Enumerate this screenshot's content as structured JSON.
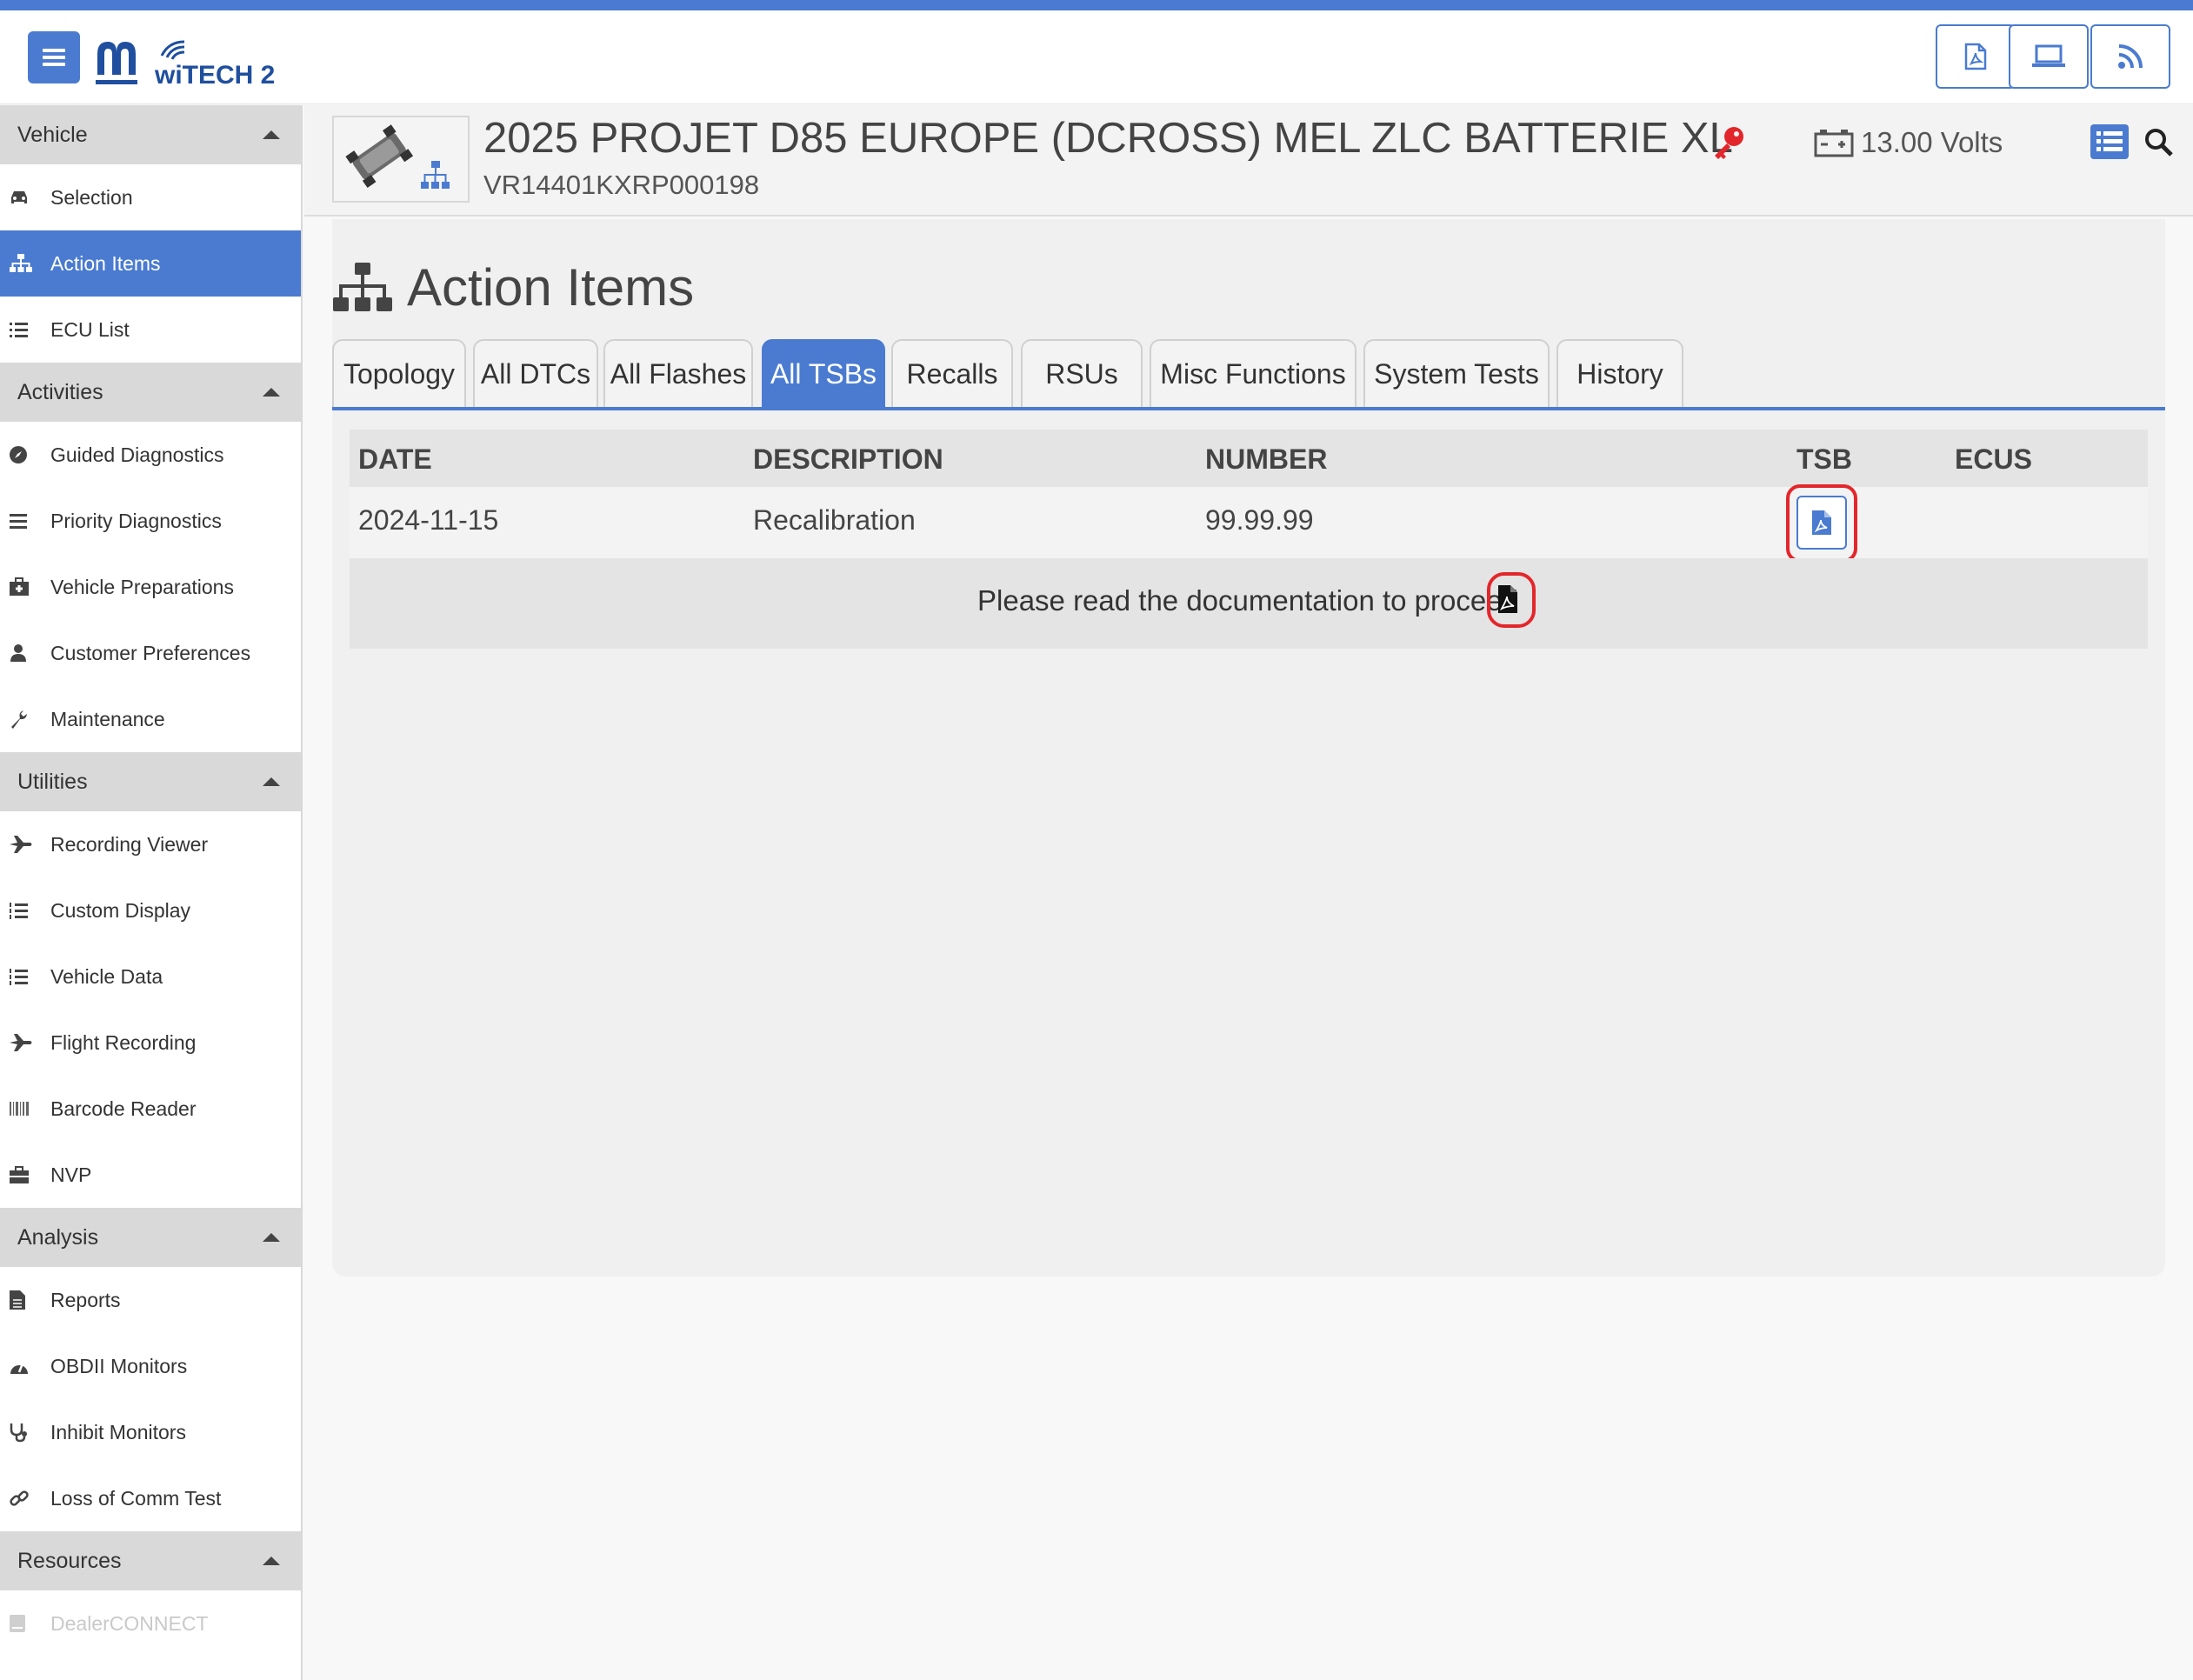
{
  "app": {
    "logo_text": "wiTECH 2",
    "accent_color": "#4a7bd0",
    "alert_color": "#e3262b"
  },
  "top_actions": [
    {
      "icon": "pdf-icon"
    },
    {
      "icon": "laptop-icon"
    },
    {
      "icon": "rss-icon"
    }
  ],
  "sidebar": {
    "sections": [
      {
        "title": "Vehicle",
        "items": [
          {
            "label": "Selection",
            "icon": "car-icon"
          },
          {
            "label": "Action Items",
            "icon": "sitemap-icon",
            "active": true
          },
          {
            "label": "ECU List",
            "icon": "list-icon"
          }
        ]
      },
      {
        "title": "Activities",
        "items": [
          {
            "label": "Guided Diagnostics",
            "icon": "compass-icon"
          },
          {
            "label": "Priority Diagnostics",
            "icon": "bars-icon"
          },
          {
            "label": "Vehicle Preparations",
            "icon": "medkit-icon"
          },
          {
            "label": "Customer Preferences",
            "icon": "user-icon"
          },
          {
            "label": "Maintenance",
            "icon": "wrench-icon"
          }
        ]
      },
      {
        "title": "Utilities",
        "items": [
          {
            "label": "Recording Viewer",
            "icon": "plane-icon"
          },
          {
            "label": "Custom Display",
            "icon": "list-ol-icon"
          },
          {
            "label": "Vehicle Data",
            "icon": "list-ol-icon"
          },
          {
            "label": "Flight Recording",
            "icon": "plane-icon"
          },
          {
            "label": "Barcode Reader",
            "icon": "barcode-icon"
          },
          {
            "label": "NVP",
            "icon": "briefcase-icon"
          }
        ]
      },
      {
        "title": "Analysis",
        "items": [
          {
            "label": "Reports",
            "icon": "file-icon"
          },
          {
            "label": "OBDII Monitors",
            "icon": "gauge-icon"
          },
          {
            "label": "Inhibit Monitors",
            "icon": "stethoscope-icon"
          },
          {
            "label": "Loss of Comm Test",
            "icon": "link-icon"
          }
        ]
      },
      {
        "title": "Resources",
        "items": [
          {
            "label": "DealerCONNECT",
            "icon": "book-icon",
            "disabled": true
          }
        ]
      }
    ]
  },
  "vehicle": {
    "title": "2025 PROJET D85 EUROPE (DCROSS) MEL ZLC BATTERIE XL",
    "vin": "VR14401KXRP000198",
    "voltage": "13.00 Volts"
  },
  "page": {
    "title": "Action Items",
    "tabs": [
      {
        "label": "Topology"
      },
      {
        "label": "All DTCs"
      },
      {
        "label": "All Flashes"
      },
      {
        "label": "All TSBs",
        "active": true
      },
      {
        "label": "Recalls"
      },
      {
        "label": "RSUs"
      },
      {
        "label": "Misc Functions"
      },
      {
        "label": "System Tests"
      },
      {
        "label": "History"
      }
    ]
  },
  "table": {
    "columns": [
      "DATE",
      "DESCRIPTION",
      "NUMBER",
      "TSB",
      "ECUS"
    ],
    "rows": [
      {
        "date": "2024-11-15",
        "description": "Recalibration",
        "number": "99.99.99",
        "tsb_icon": "pdf-icon",
        "ecus": ""
      }
    ],
    "note": "Please read the documentation to proceed"
  }
}
